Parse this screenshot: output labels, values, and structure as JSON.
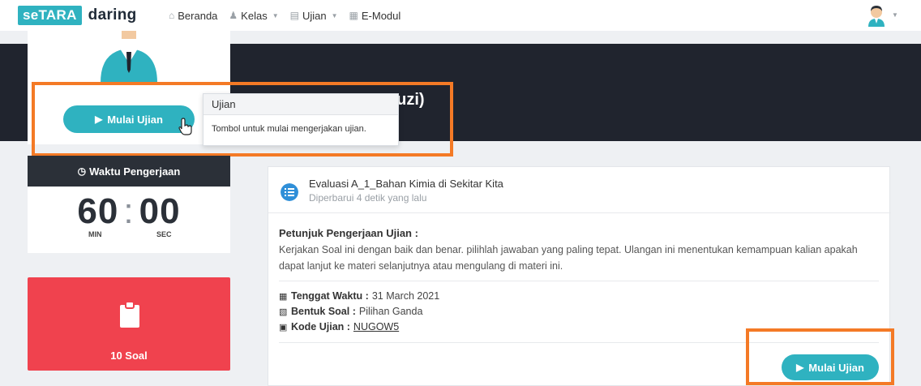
{
  "navbar": {
    "logo_se": "seTARA",
    "logo_daring": "daring",
    "items": [
      {
        "label": "Beranda",
        "icon": "home-icon",
        "has_caret": false
      },
      {
        "label": "Kelas",
        "icon": "users-icon",
        "has_caret": true
      },
      {
        "label": "Ujian",
        "icon": "book-icon",
        "has_caret": true
      },
      {
        "label": "E-Modul",
        "icon": "ebook-icon",
        "has_caret": false
      }
    ]
  },
  "header": {
    "title_partial": "auzi)"
  },
  "profile": {
    "start_button_label": "Mulai Ujian"
  },
  "tooltip": {
    "title": "Ujian",
    "body": "Tombol untuk mulai mengerjakan ujian."
  },
  "timer": {
    "header_label": "Waktu Pengerjaan",
    "minutes": "60",
    "seconds": "00",
    "separator": ":",
    "min_label": "MIN",
    "sec_label": "SEC"
  },
  "soal": {
    "label": "10 Soal",
    "color": "#f0424e"
  },
  "exam": {
    "title": "Evaluasi A_1_Bahan Kimia di Sekitar Kita",
    "updated": "Diperbarui 4 detik yang lalu",
    "instructions_title": "Petunjuk Pengerjaan Ujian :",
    "instructions_body": "Kerjakan Soal ini dengan baik dan benar. pilihlah jawaban yang paling tepat. Ulangan ini menentukan kemampuan kalian apakah dapat lanjut ke materi selanjutnya atau mengulang di materi ini.",
    "deadline_label": "Tenggat Waktu :",
    "deadline_value": "31 March 2021",
    "type_label": "Bentuk Soal :",
    "type_value": "Pilihan Ganda",
    "code_label": "Kode Ujian :",
    "code_value": "NUGOW5",
    "start_button_label": "Mulai Ujian"
  },
  "colors": {
    "accent": "#2fb2c0",
    "highlight": "#f47a26",
    "dark_band": "#20242e"
  }
}
